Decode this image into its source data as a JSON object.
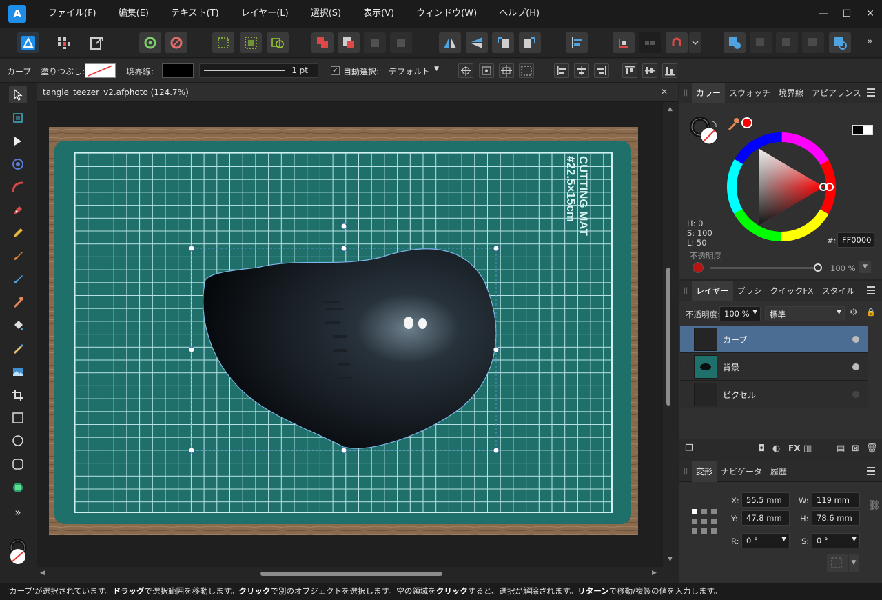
{
  "menu": {
    "items": [
      "ファイル(F)",
      "編集(E)",
      "テキスト(T)",
      "レイヤー(L)",
      "選択(S)",
      "表示(V)",
      "ウィンドウ(W)",
      "ヘルプ(H)"
    ]
  },
  "window_controls": {
    "minimize": "—",
    "maximize": "☐",
    "close": "✕"
  },
  "context": {
    "tool_name": "カーブ",
    "fill_label": "塗りつぶし:",
    "stroke_label": "境界線:",
    "stroke_width": "1 pt",
    "auto_select_label": "自動選択:",
    "auto_select_value": "デフォルト"
  },
  "document": {
    "tab_title": "tangle_teezer_v2.afphoto (124.7%)",
    "close": "✕"
  },
  "status": {
    "parts": [
      {
        "t": "'カーブ'が選択されています。",
        "b": false
      },
      {
        "t": "ドラッグ",
        "b": true
      },
      {
        "t": "で選択範囲を移動します。",
        "b": false
      },
      {
        "t": "クリック",
        "b": true
      },
      {
        "t": "で別のオブジェクトを選択します。空の領域を",
        "b": false
      },
      {
        "t": "クリック",
        "b": true
      },
      {
        "t": "すると、選択が解除されます。",
        "b": false
      },
      {
        "t": "リターン",
        "b": true
      },
      {
        "t": "で移動/複製の値を入力します。",
        "b": false
      }
    ]
  },
  "color_panel": {
    "tabs": [
      "カラー",
      "スウォッチ",
      "境界線",
      "アピアランス"
    ],
    "h": "H: 0",
    "s": "S: 100",
    "l": "L: 50",
    "hex_label": "#:",
    "hex_value": "FF0000",
    "opacity_label": "不透明度",
    "opacity_value": "100 %",
    "fill_color": "#ff0000"
  },
  "layers_panel": {
    "tabs": [
      "レイヤー",
      "ブラシ",
      "クイックFX",
      "スタイル"
    ],
    "opacity_label": "不透明度:",
    "opacity_value": "100 %",
    "blend_mode": "標準",
    "layers": [
      {
        "name": "カーブ",
        "selected": true
      },
      {
        "name": "背景",
        "selected": false
      },
      {
        "name": "ピクセル",
        "selected": false
      }
    ]
  },
  "transform_panel": {
    "tabs": [
      "変形",
      "ナビゲータ",
      "履歴"
    ],
    "x_label": "X:",
    "x_value": "55.5 mm",
    "y_label": "Y:",
    "y_value": "47.8 mm",
    "w_label": "W:",
    "w_value": "119 mm",
    "h_label": "H:",
    "h_value": "78.6 mm",
    "r_label": "R:",
    "r_value": "0 °",
    "s_label": "S:",
    "s_value": "0 °"
  },
  "canvas": {
    "mat_text_1": "CUTTING MAT",
    "mat_text_2": "#22.5×15cm"
  }
}
